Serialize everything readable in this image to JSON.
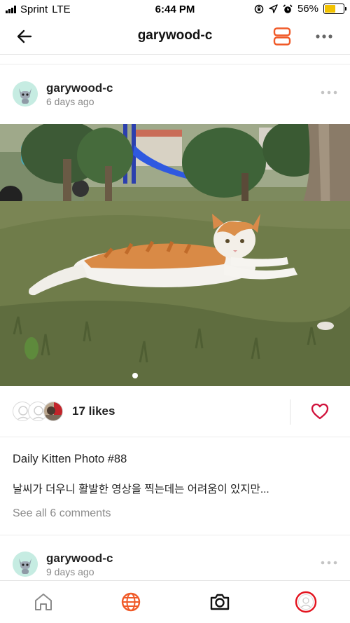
{
  "status_bar": {
    "carrier": "Sprint",
    "network": "LTE",
    "time": "6:44 PM",
    "battery_percent": "56%",
    "battery_level": 0.56,
    "icons": [
      "signal-icon",
      "lock-rotation-icon",
      "location-arrow-icon",
      "alarm-icon",
      "battery-icon"
    ]
  },
  "nav": {
    "title": "garywood-c",
    "accent_color": "#f05a28"
  },
  "post": {
    "username": "garywood-c",
    "time_ago": "6 days ago",
    "likes_label": "17 likes",
    "caption_title": "Daily Kitten Photo #88",
    "caption_body": "날씨가 더우니 활발한 영상을 찍는데는 어려움이 있지만...",
    "see_comments": "See all 6 comments",
    "heart_color": "#d0103a"
  },
  "next_post": {
    "username": "garywood-c",
    "time_ago": "9 days ago"
  },
  "tabbar": {
    "tabs": [
      "home-icon",
      "globe-icon",
      "camera-icon",
      "profile-icon"
    ]
  }
}
